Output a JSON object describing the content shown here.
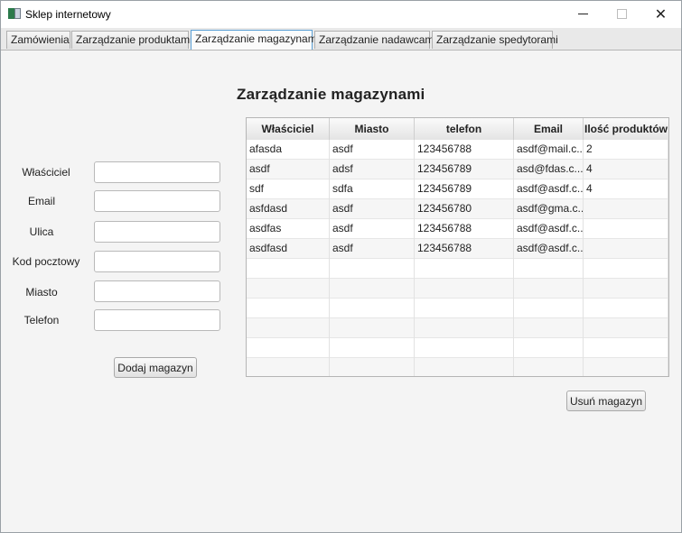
{
  "window": {
    "title": "Sklep internetowy",
    "minimize_glyph": "—",
    "maximize_glyph": "☐",
    "close_glyph": "✕"
  },
  "tabs": [
    {
      "label": "Zamówienia",
      "active": false
    },
    {
      "label": "Zarządzanie produktami",
      "active": false
    },
    {
      "label": "Zarządzanie magazynami",
      "active": true
    },
    {
      "label": "Zarządzanie nadawcami",
      "active": false
    },
    {
      "label": "Zarządzanie spedytorami",
      "active": false
    }
  ],
  "page": {
    "heading": "Zarządzanie magazynami"
  },
  "form": {
    "fields": [
      {
        "label": "Właściciel",
        "value": ""
      },
      {
        "label": "Email",
        "value": ""
      },
      {
        "label": "Ulica",
        "value": ""
      },
      {
        "label": "Kod pocztowy",
        "value": ""
      },
      {
        "label": "Miasto",
        "value": ""
      },
      {
        "label": "Telefon",
        "value": ""
      }
    ],
    "add_button": "Dodaj magazyn"
  },
  "table": {
    "columns": [
      "Właściciel",
      "Miasto",
      "telefon",
      "Email",
      "Ilość produktów"
    ],
    "rows": [
      [
        "afasda",
        "asdf",
        "123456788",
        "asdf@mail.c...",
        "2"
      ],
      [
        "asdf",
        "adsf",
        "123456789",
        "asd@fdas.c...",
        "4"
      ],
      [
        "sdf",
        "sdfa",
        "123456789",
        "asdf@asdf.c...",
        "4"
      ],
      [
        "asfdasd",
        "asdf",
        "123456780",
        "asdf@gma.c...",
        ""
      ],
      [
        "asdfas",
        "asdf",
        "123456788",
        "asdf@asdf.c...",
        ""
      ],
      [
        "asdfasd",
        "asdf",
        "123456788",
        "asdf@asdf.c...",
        ""
      ]
    ]
  },
  "delete_button": "Usuń magazyn",
  "colors": {
    "active_tab_border": "#5aa0d6",
    "window_bg": "#f4f4f4"
  }
}
